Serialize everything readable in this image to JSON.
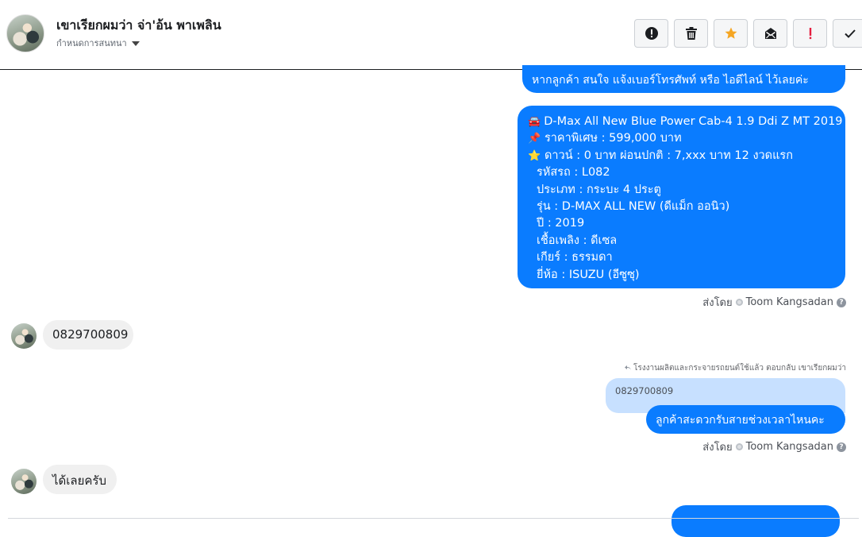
{
  "header": {
    "title": "เขาเรียกผมว่า จ่า'อ้น พาเพลิน",
    "subtitle": "กำหนดการสนทนา",
    "actions": [
      {
        "name": "report-icon",
        "color": "#1c1e21"
      },
      {
        "name": "trash-icon",
        "color": "#1c1e21"
      },
      {
        "name": "star-icon",
        "color": "#f5a623"
      },
      {
        "name": "mark-unread-icon",
        "color": "#1c1e21"
      },
      {
        "name": "important-icon",
        "color": "#e41e3f"
      },
      {
        "name": "done-check-icon",
        "color": "#1c1e21"
      }
    ]
  },
  "messages": {
    "out1": "หากลูกค้า สนใจ แจ้งเบอร์โทรศัพท์ หรือ ไอดีไลน์  ไว้เลยค่ะ",
    "out2": {
      "lines": [
        {
          "icon": "car-icon",
          "glyph": "🚘",
          "text": "D-Max All New Blue Power Cab-4 1.9 Ddi Z MT 2019"
        },
        {
          "icon": "pin-icon",
          "glyph": "📌",
          "text": "ราคาพิเศษ : 599,000 บาท"
        },
        {
          "icon": "star-emoji-icon",
          "glyph": "⭐",
          "text": "ดาวน์ : 0 บาท ผ่อนปกติ : 7,xxx บาท 12 งวดแรก"
        },
        {
          "text": "รหัสรถ : L082"
        },
        {
          "text": "ประเภท : กระบะ 4 ประตู"
        },
        {
          "text": "รุ่น : D-MAX ALL NEW (ดีแม็ก ออนิว)"
        },
        {
          "text": "ปี : 2019"
        },
        {
          "text": "เชื้อเพลิง : ดีเซล"
        },
        {
          "text": "เกียร์ : ธรรมดา"
        },
        {
          "text": "ยี่ห้อ : ISUZU (อีซูซุ)"
        }
      ]
    },
    "sent_by_label": "ส่งโดย",
    "sender_name": "Toom Kangsadan",
    "help_glyph": "?",
    "in1": "0829700809",
    "reply_note": "โรงงานผลิตและกระจายรถยนต์ใช้แล้ว ตอบกลับ เขาเรียกผมว่า",
    "quoted": "0829700809",
    "out3": "ลูกค้าสะดวกรับสายช่วงเวลาไหนคะ",
    "in2": "ได้เลยครับ"
  },
  "colors": {
    "outgoing_bubble": "#0a7cff",
    "incoming_bubble": "#f0f0f0",
    "quote_bubble": "#c7e0ff"
  }
}
